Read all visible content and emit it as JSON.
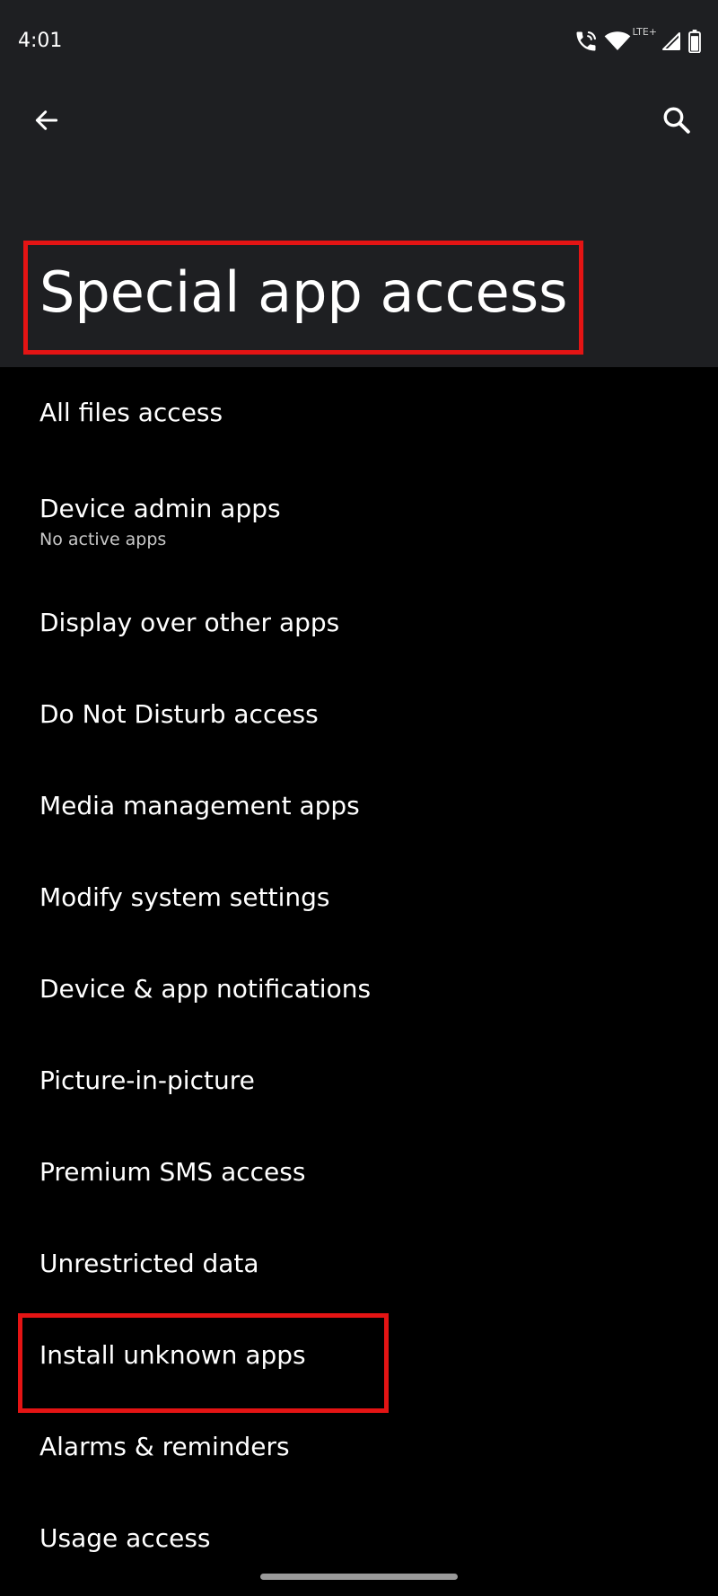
{
  "status_bar": {
    "time": "4:01",
    "network_label": "LTE+",
    "icons": [
      "wifi-calling-icon",
      "wifi-icon",
      "cell-signal-icon",
      "battery-icon"
    ]
  },
  "app_bar": {
    "back_icon": "arrow-left-icon",
    "search_icon": "search-icon"
  },
  "title": "Special app access",
  "items": [
    {
      "title": "All files access",
      "subtitle": ""
    },
    {
      "title": "Device admin apps",
      "subtitle": "No active apps"
    },
    {
      "title": "Display over other apps",
      "subtitle": ""
    },
    {
      "title": "Do Not Disturb access",
      "subtitle": ""
    },
    {
      "title": "Media management apps",
      "subtitle": ""
    },
    {
      "title": "Modify system settings",
      "subtitle": ""
    },
    {
      "title": "Device & app notifications",
      "subtitle": ""
    },
    {
      "title": "Picture-in-picture",
      "subtitle": ""
    },
    {
      "title": "Premium SMS access",
      "subtitle": ""
    },
    {
      "title": "Unrestricted data",
      "subtitle": ""
    },
    {
      "title": "Install unknown apps",
      "subtitle": ""
    },
    {
      "title": "Alarms & reminders",
      "subtitle": ""
    },
    {
      "title": "Usage access",
      "subtitle": ""
    }
  ],
  "colors": {
    "header_background": "#1e1f22",
    "list_background": "#000000",
    "text_primary": "#ffffff",
    "text_secondary": "#c9c9c9",
    "highlight": "#e41414"
  }
}
